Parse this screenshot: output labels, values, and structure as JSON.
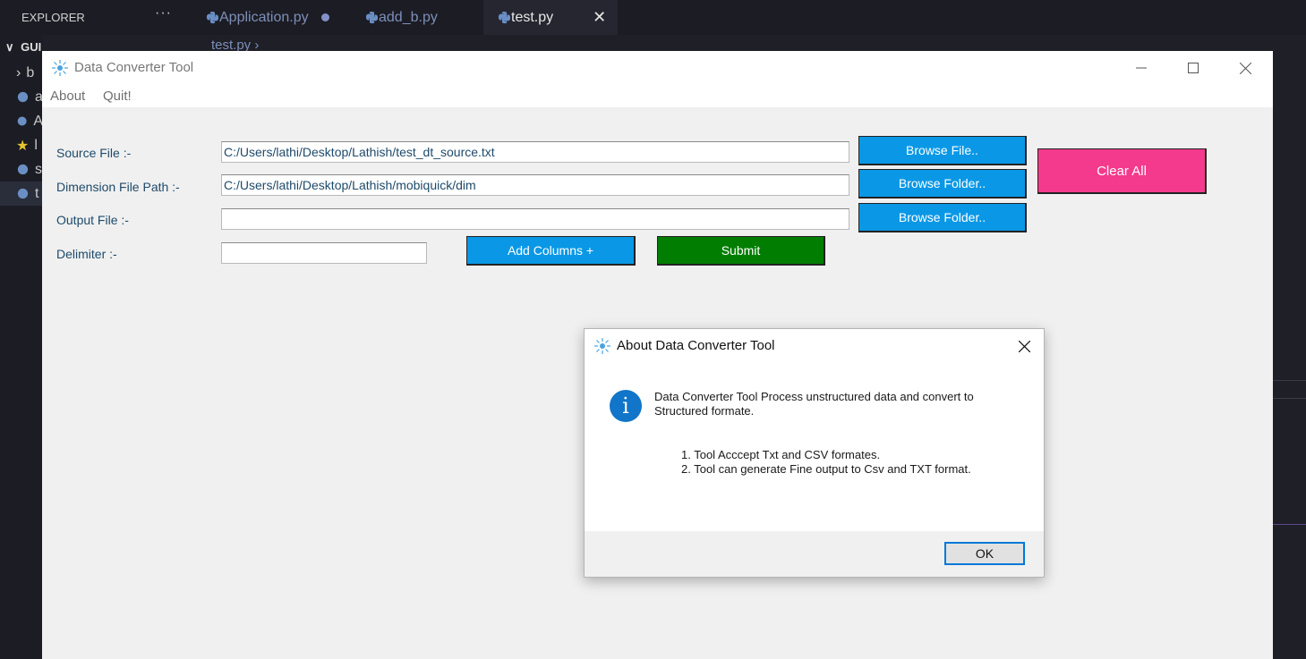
{
  "vscode": {
    "explorer_title": "EXPLORER",
    "more_glyph": "···",
    "tabs": [
      {
        "label": "Application.py",
        "modified": true
      },
      {
        "label": "add_b.py"
      },
      {
        "label": "test.py",
        "active": true
      }
    ],
    "tab_close_glyph": "✕",
    "folder_label": "GUI",
    "breadcrumb": "test.py",
    "sidebar_rows": [
      "b",
      "a",
      "A",
      "l",
      "s",
      "t"
    ],
    "icons": [
      "python-file-icon",
      "star-icon",
      "chevron-right-icon"
    ]
  },
  "app": {
    "title": "Data Converter Tool",
    "menu": [
      "About",
      "Quit!"
    ],
    "fields": [
      {
        "label": "Source File :-",
        "value": "C:/Users/lathi/Desktop/Lathish/test_dt_source.txt"
      },
      {
        "label": "Dimension File Path :-",
        "value": "C:/Users/lathi/Desktop/Lathish/mobiquick/dim"
      },
      {
        "label": "Output File :-",
        "value": ""
      },
      {
        "label": "Delimiter :-",
        "value": ""
      }
    ],
    "buttons": {
      "browse_file": "Browse File..",
      "browse_folder_1": "Browse Folder..",
      "browse_folder_2": "Browse Folder..",
      "add_columns": "Add Columns +",
      "submit": "Submit",
      "clear_all": "Clear All"
    },
    "colors": {
      "button_blue": "#0a98e6",
      "button_green": "#017e01",
      "button_pink": "#f43a8c",
      "label_text": "#1e4a6a"
    }
  },
  "dialog": {
    "title": "About Data Converter Tool",
    "icon": "info-icon",
    "message_line1": "Data Converter Tool Process unstructured data and convert to",
    "message_line2": "Structured formate.",
    "list": [
      "1. Tool Acccept Txt and CSV formates.",
      "2. Tool can generate Fine output to Csv and TXT format."
    ],
    "ok_label": "OK"
  }
}
